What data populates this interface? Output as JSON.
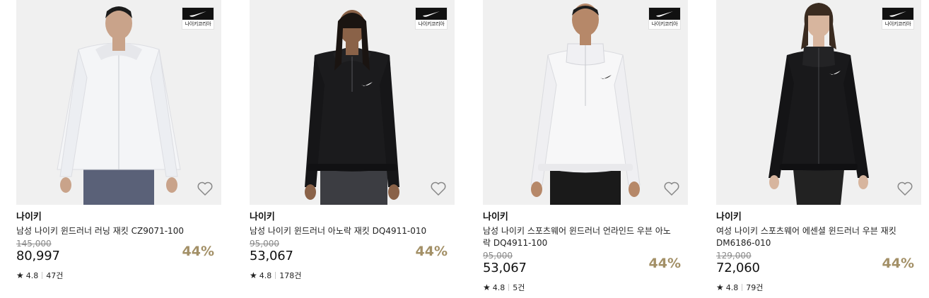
{
  "colors": {
    "discount": "#a39067",
    "image_bg": "#f0f0f0",
    "strike": "#8a8a8a"
  },
  "badge_text": "나이키코리아",
  "products": [
    {
      "brand": "나이키",
      "name": "남성 나이키 윈드러너 러닝 재킷 CZ9071-100",
      "original_price": "145,000",
      "price": "80,997",
      "discount": "44%",
      "star": "★",
      "rating": "4.8",
      "reviews": "47건",
      "image_subject": "white-running-jacket",
      "jacket_color": "#f4f5f7",
      "pants_color": "#5a6178"
    },
    {
      "brand": "나이키",
      "name": "남성 나이키 윈드러너 아노락 재킷 DQ4911-010",
      "original_price": "95,000",
      "price": "53,067",
      "discount": "44%",
      "star": "★",
      "rating": "4.8",
      "reviews": "178건",
      "image_subject": "black-anorak-jacket",
      "jacket_color": "#1b1b1d",
      "pants_color": "#3c3d42"
    },
    {
      "brand": "나이키",
      "name": "남성 나이키 스포츠웨어 윈드러너 언라인드 우븐 아노락 DQ4911-100",
      "original_price": "95,000",
      "price": "53,067",
      "discount": "44%",
      "star": "★",
      "rating": "4.8",
      "reviews": "5건",
      "image_subject": "white-anorak-jacket",
      "jacket_color": "#f7f7f8",
      "pants_color": "#1a1a1a"
    },
    {
      "brand": "나이키",
      "name": "여성 나이키 스포츠웨어 에센셜 윈드러너 우븐 재킷 DM6186-010",
      "original_price": "129,000",
      "price": "72,060",
      "discount": "44%",
      "star": "★",
      "rating": "4.8",
      "reviews": "79건",
      "image_subject": "black-womens-jacket",
      "jacket_color": "#19191b",
      "pants_color": "#222222"
    }
  ]
}
